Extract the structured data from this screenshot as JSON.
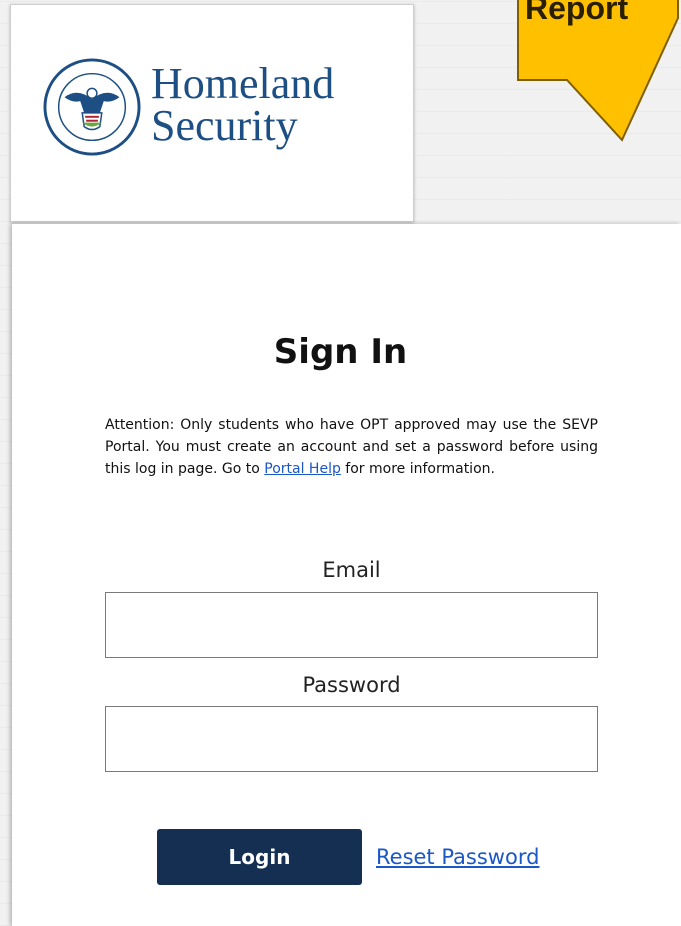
{
  "logo": {
    "line1": "Homeland",
    "line2": "Security",
    "seal_label": "U.S. DEPARTMENT OF HOMELAND SECURITY",
    "text_color": "#1d4f84"
  },
  "callout": {
    "text": "Report",
    "color": "#ffc000"
  },
  "signin": {
    "title": "Sign In",
    "notice_before": "Attention: Only students who have OPT approved may use the SEVP Portal. You must create an account and set a password before using this log in page. Go to ",
    "notice_link": "Portal Help",
    "notice_after": " for more information.",
    "email_label": "Email",
    "email_value": "",
    "password_label": "Password",
    "password_value": "",
    "login_label": "Login",
    "reset_label": "Reset Password"
  },
  "colors": {
    "button": "#142f52",
    "link": "#1a57c7"
  }
}
